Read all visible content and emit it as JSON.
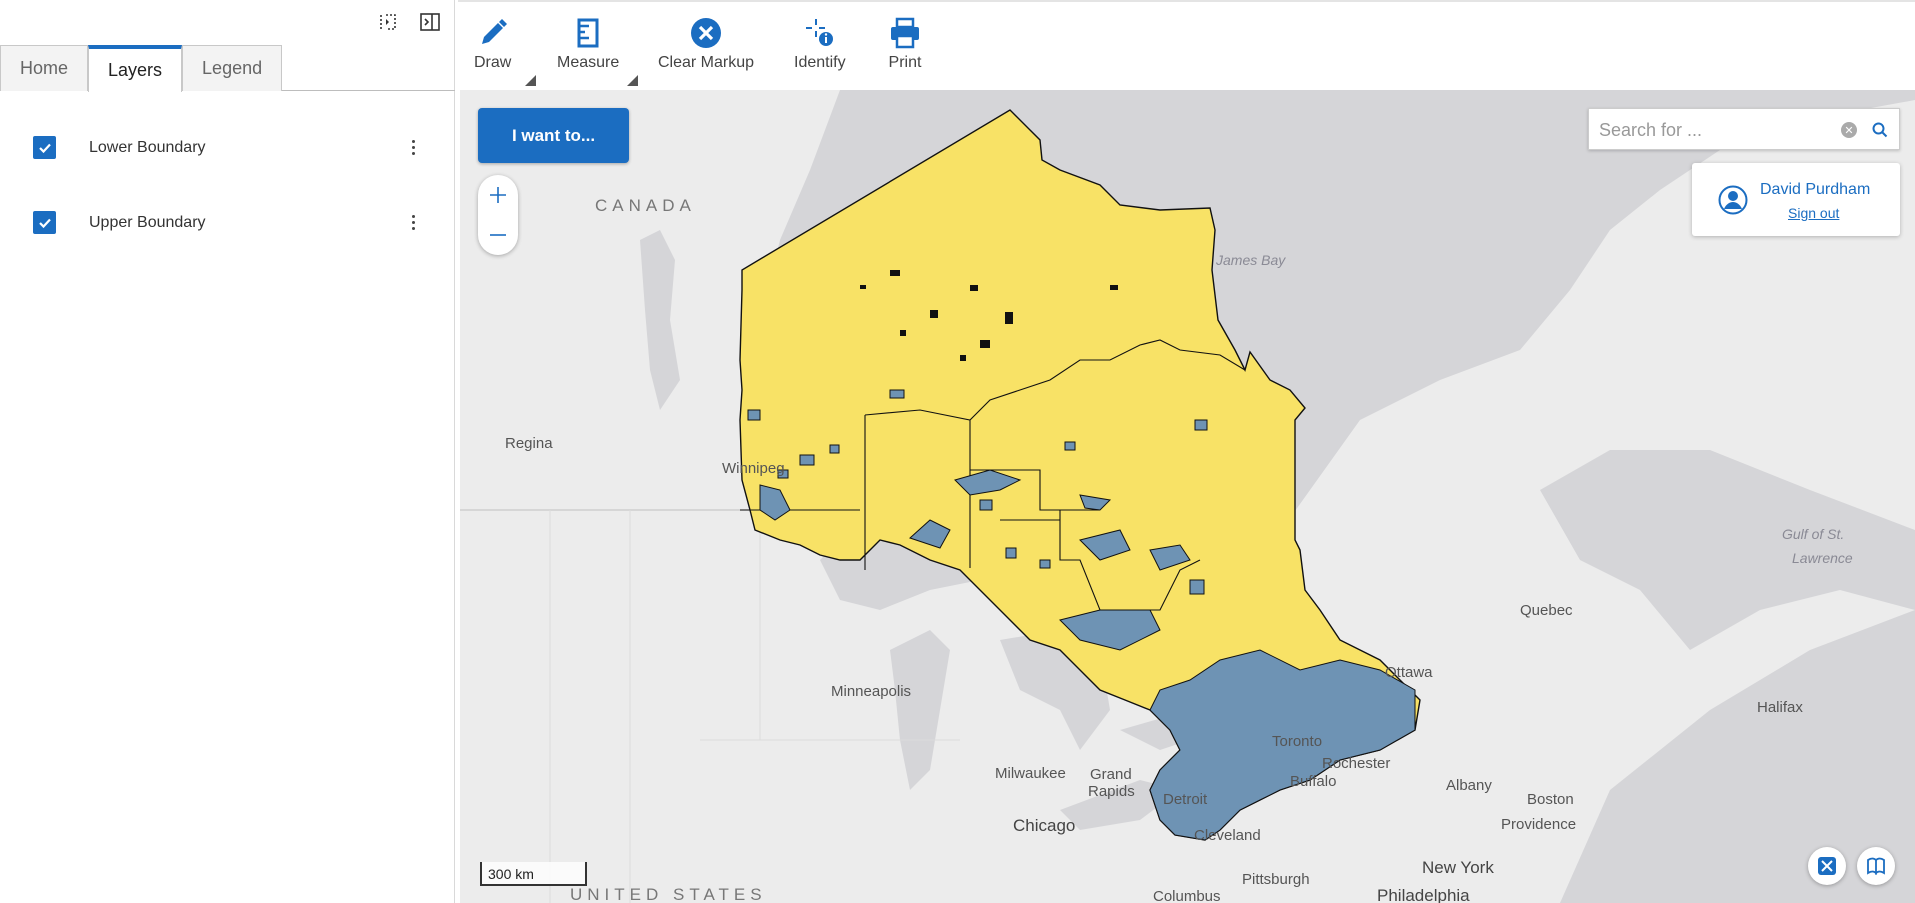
{
  "panel": {
    "tabs": [
      {
        "label": "Home",
        "active": false
      },
      {
        "label": "Layers",
        "active": true
      },
      {
        "label": "Legend",
        "active": false
      }
    ],
    "layers": [
      {
        "label": "Lower Boundary",
        "checked": true
      },
      {
        "label": "Upper Boundary",
        "checked": true
      }
    ]
  },
  "toolbar": {
    "draw": "Draw",
    "measure": "Measure",
    "clear_markup": "Clear Markup",
    "identify": "Identify",
    "print": "Print"
  },
  "map": {
    "i_want_to": "I want to...",
    "search_placeholder": "Search for ...",
    "user_name": "David Purdham",
    "sign_out": "Sign out",
    "scale": "300 km",
    "labels": {
      "canada": "CANADA",
      "united_states": "UNITED STATES",
      "james_bay": "James Bay",
      "gulf_st_lawrence_1": "Gulf of St.",
      "gulf_st_lawrence_2": "Lawrence",
      "regina": "Regina",
      "winnipeg": "Winnipeg",
      "quebec": "Quebec",
      "ottawa": "Ottawa",
      "halifax": "Halifax",
      "minneapolis": "Minneapolis",
      "milwaukee": "Milwaukee",
      "grand_rapids_1": "Grand",
      "grand_rapids_2": "Rapids",
      "toronto": "Toronto",
      "rochester": "Rochester",
      "buffalo": "Buffalo",
      "albany": "Albany",
      "boston": "Boston",
      "providence": "Providence",
      "detroit": "Detroit",
      "chicago": "Chicago",
      "cleveland": "Cleveland",
      "pittsburgh": "Pittsburgh",
      "new_york": "New York",
      "columbus": "Columbus",
      "philadelphia": "Philadelphia"
    },
    "colors": {
      "upper_fill": "#f8e266",
      "lower_fill": "#6e93b4",
      "land": "#ececec",
      "water": "#d5d5d8",
      "accent": "#1b6dc1"
    }
  }
}
